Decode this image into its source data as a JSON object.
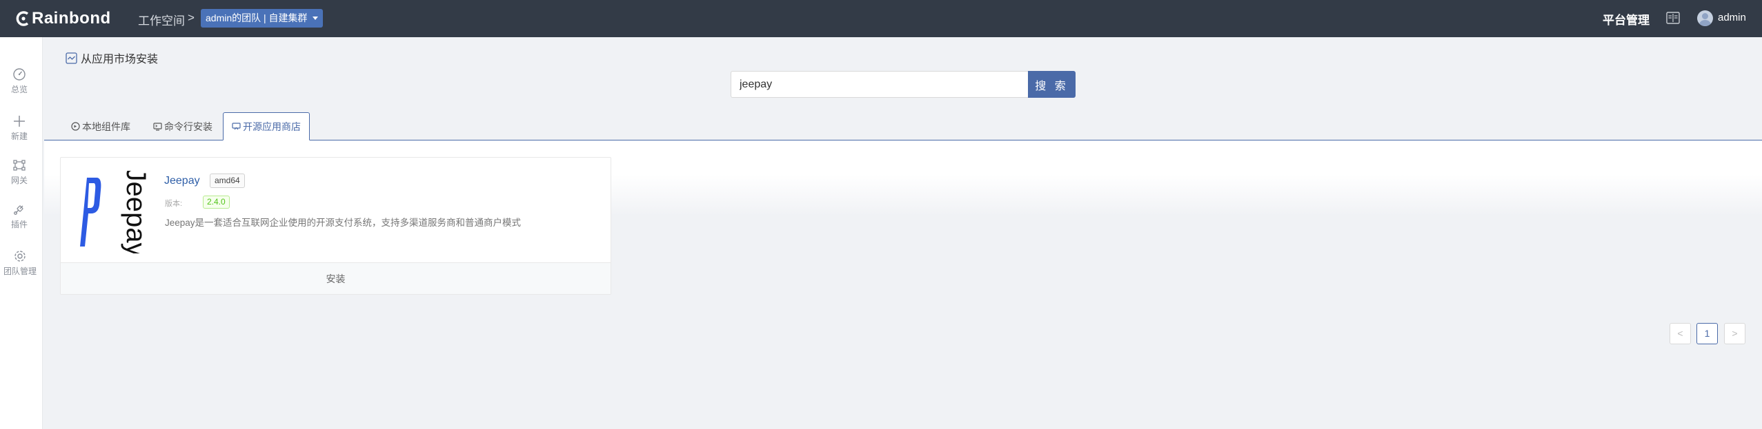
{
  "header": {
    "logo_text": "Rainbond",
    "workspace_label": "工作空间",
    "separator": ">",
    "team_selector": "admin的团队 | 自建集群",
    "platform_mgmt": "平台管理",
    "username": "admin"
  },
  "sidebar": {
    "items": [
      {
        "label": "总览",
        "icon": "dashboard-icon"
      },
      {
        "label": "新建",
        "icon": "plus-icon"
      },
      {
        "label": "网关",
        "icon": "gateway-icon"
      },
      {
        "label": "插件",
        "icon": "plugin-icon"
      },
      {
        "label": "团队管理",
        "icon": "gear-icon"
      }
    ]
  },
  "page": {
    "title": "从应用市场安装"
  },
  "search": {
    "value": "jeepay",
    "button_label": "搜 索"
  },
  "tabs": [
    {
      "label": "本地组件库",
      "active": false
    },
    {
      "label": "命令行安装",
      "active": false
    },
    {
      "label": "开源应用商店",
      "active": true
    }
  ],
  "results": [
    {
      "name": "Jeepay",
      "arch": "amd64",
      "version_label": "版本:",
      "version": "2.4.0",
      "description": "Jeepay是一套适合互联网企业使用的开源支付系统，支持多渠道服务商和普通商户模式",
      "action": "安装",
      "logo_text": "Jeepay"
    }
  ],
  "pagination": {
    "prev": "<",
    "current": "1",
    "next": ">"
  },
  "colors": {
    "header_bg": "#333b47",
    "accent": "#4a6aa8",
    "version_green": "#52c41a",
    "logo_blue": "#2d5be3"
  }
}
